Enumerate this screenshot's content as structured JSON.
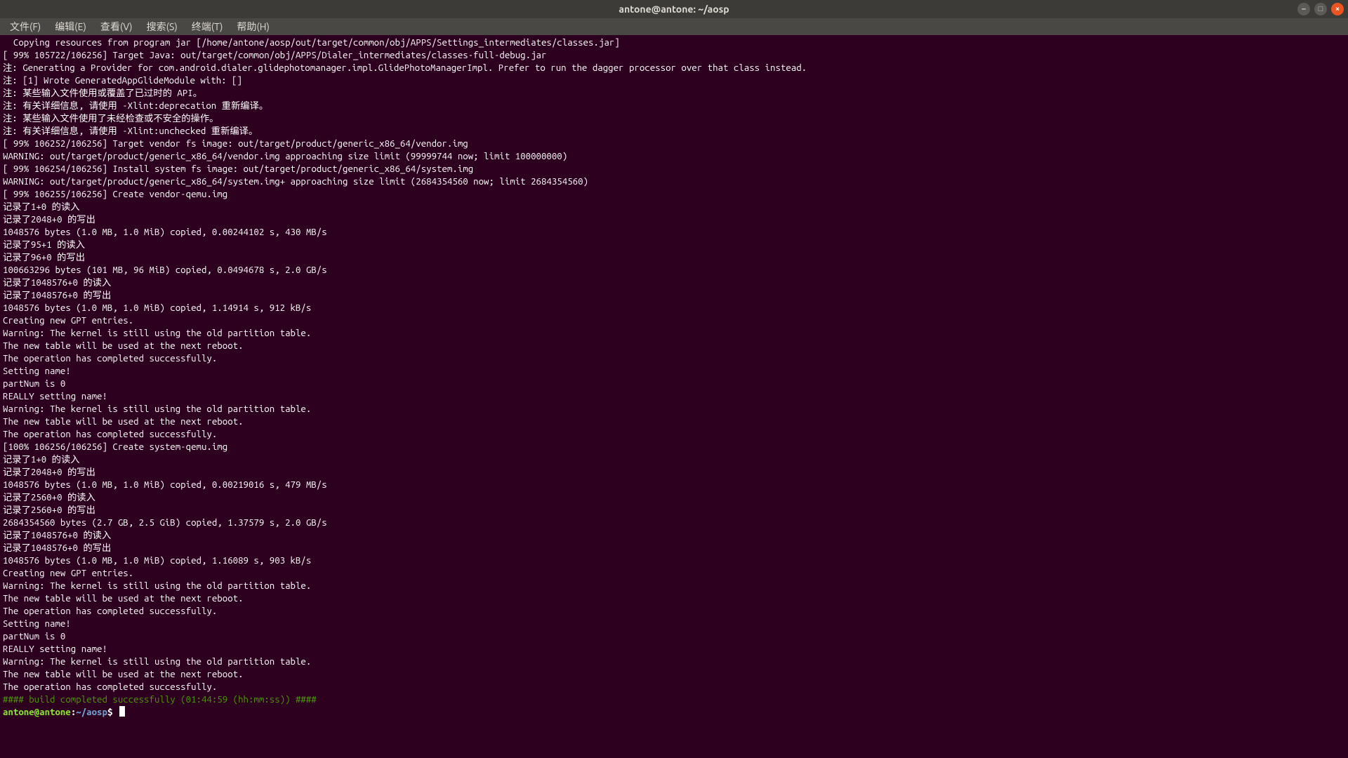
{
  "window": {
    "title": "antone@antone: ~/aosp"
  },
  "menu": {
    "file": "文件(F)",
    "edit": "编辑(E)",
    "view": "查看(V)",
    "search": "搜索(S)",
    "terminal": "终端(T)",
    "help": "帮助(H)"
  },
  "prompt": {
    "user": "antone@antone",
    "sep": ":",
    "path": "~/aosp",
    "sym": "$"
  },
  "success_line": "#### build completed successfully (01:44:59 (hh:mm:ss)) ####",
  "lines": [
    "  Copying resources from program jar [/home/antone/aosp/out/target/common/obj/APPS/Settings_intermediates/classes.jar]",
    "[ 99% 105722/106256] Target Java: out/target/common/obj/APPS/Dialer_intermediates/classes-full-debug.jar",
    "注: Generating a Provider for com.android.dialer.glidephotomanager.impl.GlidePhotoManagerImpl. Prefer to run the dagger processor over that class instead.",
    "注: [1] Wrote GeneratedAppGlideModule with: []",
    "注: 某些输入文件使用或覆盖了已过时的 API。",
    "注: 有关详细信息, 请使用 -Xlint:deprecation 重新编译。",
    "注: 某些输入文件使用了未经检查或不安全的操作。",
    "注: 有关详细信息, 请使用 -Xlint:unchecked 重新编译。",
    "[ 99% 106252/106256] Target vendor fs image: out/target/product/generic_x86_64/vendor.img",
    "WARNING: out/target/product/generic_x86_64/vendor.img approaching size limit (99999744 now; limit 100000000)",
    "[ 99% 106254/106256] Install system fs image: out/target/product/generic_x86_64/system.img",
    "WARNING: out/target/product/generic_x86_64/system.img+ approaching size limit (2684354560 now; limit 2684354560)",
    "[ 99% 106255/106256] Create vendor-qemu.img",
    "记录了1+0 的读入",
    "记录了2048+0 的写出",
    "1048576 bytes (1.0 MB, 1.0 MiB) copied, 0.00244102 s, 430 MB/s",
    "记录了95+1 的读入",
    "记录了96+0 的写出",
    "100663296 bytes (101 MB, 96 MiB) copied, 0.0494678 s, 2.0 GB/s",
    "记录了1048576+0 的读入",
    "记录了1048576+0 的写出",
    "1048576 bytes (1.0 MB, 1.0 MiB) copied, 1.14914 s, 912 kB/s",
    "Creating new GPT entries.",
    "Warning: The kernel is still using the old partition table.",
    "The new table will be used at the next reboot.",
    "The operation has completed successfully.",
    "Setting name!",
    "partNum is 0",
    "REALLY setting name!",
    "Warning: The kernel is still using the old partition table.",
    "The new table will be used at the next reboot.",
    "The operation has completed successfully.",
    "[100% 106256/106256] Create system-qemu.img",
    "记录了1+0 的读入",
    "记录了2048+0 的写出",
    "1048576 bytes (1.0 MB, 1.0 MiB) copied, 0.00219016 s, 479 MB/s",
    "记录了2560+0 的读入",
    "记录了2560+0 的写出",
    "2684354560 bytes (2.7 GB, 2.5 GiB) copied, 1.37579 s, 2.0 GB/s",
    "记录了1048576+0 的读入",
    "记录了1048576+0 的写出",
    "1048576 bytes (1.0 MB, 1.0 MiB) copied, 1.16089 s, 903 kB/s",
    "Creating new GPT entries.",
    "Warning: The kernel is still using the old partition table.",
    "The new table will be used at the next reboot.",
    "The operation has completed successfully.",
    "Setting name!",
    "partNum is 0",
    "REALLY setting name!",
    "Warning: The kernel is still using the old partition table.",
    "The new table will be used at the next reboot.",
    "The operation has completed successfully."
  ]
}
